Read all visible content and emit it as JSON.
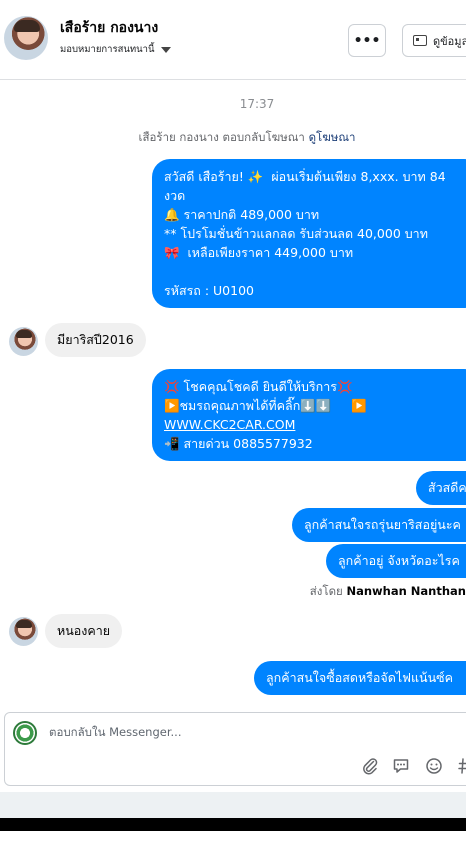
{
  "header": {
    "contact_name": "เสือร้าย กองนาง",
    "assign_label": "มอบหมายการสนทนานี้",
    "more_label": "•••",
    "info_label": "ดูข้อมูล"
  },
  "conversation": {
    "timestamp": "17:37",
    "ad_reply_prefix": "เสือร้าย กองนาง ตอบกลับโฆษณา",
    "ad_link": "ดูโฆษณา",
    "messages": [
      {
        "direction": "out",
        "lines": [
          "สวัสดี เสือร้าย! ✨  ผ่อนเริ่มต้นเพียง 8,xxx. บาท 84",
          "งวด",
          "🔔 ราคาปกติ 489,000 บาท",
          "** โปรโมชั่นข้าวแลกลด รับส่วนลด 40,000 บาท",
          "🎀  เหลือเพียงราคา 449,000 บาท",
          "",
          "รหัสรถ : U0100"
        ]
      },
      {
        "direction": "in",
        "text": "มียาริสปี2016"
      },
      {
        "direction": "out",
        "lines": [
          "💢 โชคคุณโชคดี ยินดีให้บริการ💢",
          "▶️ชมรถคุณภาพได้ที่คลิ๊ก⬇️⬇️     ▶️",
          "WWW.CKC2CAR.COM",
          "📲 สายด่วน 0885577932"
        ]
      },
      {
        "direction": "out",
        "text": "สัวสดีค"
      },
      {
        "direction": "out",
        "text": "ลูกค้าสนใจรถรุ่นยาริสอยู่นะค"
      },
      {
        "direction": "out",
        "text": "ลูกค้าอยู่ จังหวัดอะไรค"
      },
      {
        "direction": "in",
        "text": "หนองคาย"
      },
      {
        "direction": "out",
        "text": "ลูกค้าสนใจซื้อสดหรือจัดไฟแน้นซ์ค"
      }
    ],
    "sent_by_prefix": "ส่งโดย",
    "sent_by_name": "Nanwhan Nanthan"
  },
  "composer": {
    "placeholder": "ตอบกลับใน Messenger...",
    "value": ""
  },
  "icons": [
    "attachment-icon",
    "saved-reply-icon",
    "emoji-icon",
    "hashtag-icon"
  ],
  "colors": {
    "outgoing_bubble": "#0084ff",
    "incoming_bubble": "#f0f0f0",
    "link": "#1c3e77"
  }
}
